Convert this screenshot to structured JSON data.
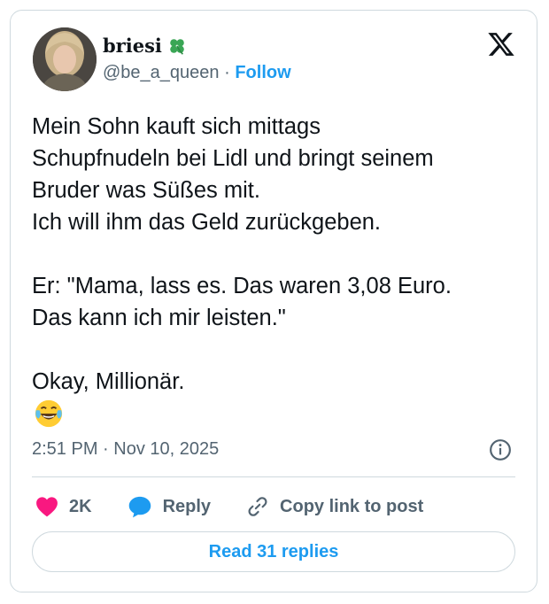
{
  "user": {
    "display_name": "briesi",
    "name_emoji": "four-leaf-clover-icon",
    "handle": "@be_a_queen",
    "separator": " · ",
    "follow_label": "Follow"
  },
  "tweet": {
    "text": "Mein Sohn kauft sich mittags\nSchupfnudeln bei Lidl und bringt seinem\nBruder was Süßes mit.\nIch will ihm das Geld zurückgeben.\n\nEr: \"Mama, lass es. Das waren 3,08 Euro.\nDas kann ich mir leisten.\"\n\nOkay, Millionär.",
    "emoji": "face-with-tears-of-joy-icon",
    "timestamp": "2:51 PM · Nov 10, 2025"
  },
  "actions": {
    "likes": "2K",
    "reply_label": "Reply",
    "copy_label": "Copy link to post"
  },
  "read_replies_label": "Read 31 replies",
  "colors": {
    "accent": "#1d9bf0",
    "heart": "#f91880",
    "text": "#0f1419",
    "muted": "#536471",
    "border": "#cfd9de"
  }
}
